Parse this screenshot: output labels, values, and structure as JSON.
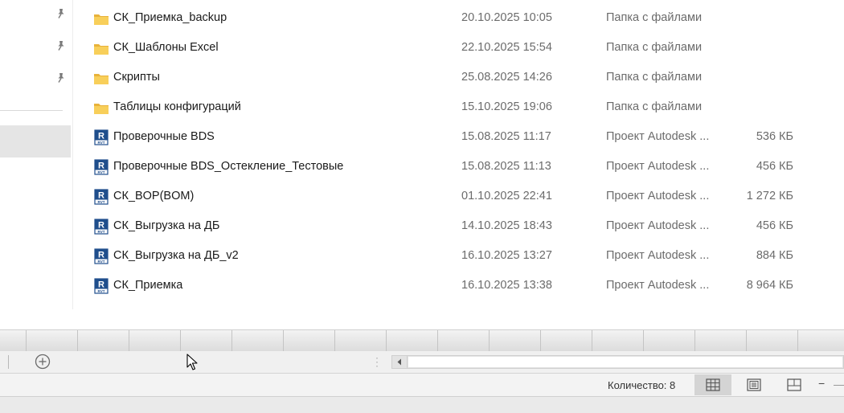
{
  "files": [
    {
      "icon": "folder-icon",
      "name": "СК_Приемка_backup",
      "date": "20.10.2025 10:05",
      "type": "Папка с файлами",
      "size": ""
    },
    {
      "icon": "folder-icon",
      "name": "СК_Шаблоны Excel",
      "date": "22.10.2025 15:54",
      "type": "Папка с файлами",
      "size": ""
    },
    {
      "icon": "folder-icon",
      "name": "Скрипты",
      "date": "25.08.2025 14:26",
      "type": "Папка с файлами",
      "size": ""
    },
    {
      "icon": "folder-icon",
      "name": "Таблицы конфигураций",
      "date": "15.10.2025 19:06",
      "type": "Папка с файлами",
      "size": ""
    },
    {
      "icon": "revit-file-icon",
      "name": "Проверочные BDS",
      "date": "15.08.2025 11:17",
      "type": "Проект Autodesk ...",
      "size": "536 КБ"
    },
    {
      "icon": "revit-file-icon",
      "name": "Проверочные BDS_Остекление_Тестовые",
      "date": "15.08.2025 11:13",
      "type": "Проект Autodesk ...",
      "size": "456 КБ"
    },
    {
      "icon": "revit-file-icon",
      "name": "СК_BOP(BOM)",
      "date": "01.10.2025 22:41",
      "type": "Проект Autodesk ...",
      "size": "1 272 КБ"
    },
    {
      "icon": "revit-file-icon",
      "name": "СК_Выгрузка на ДБ",
      "date": "14.10.2025 18:43",
      "type": "Проект Autodesk ...",
      "size": "456 КБ"
    },
    {
      "icon": "revit-file-icon",
      "name": "СК_Выгрузка на ДБ_v2",
      "date": "16.10.2025 13:27",
      "type": "Проект Autodesk ...",
      "size": "884 КБ"
    },
    {
      "icon": "revit-file-icon",
      "name": "СК_Приемка",
      "date": "16.10.2025 13:38",
      "type": "Проект Autodesk ...",
      "size": "8 964 КБ"
    }
  ],
  "status_bar": {
    "count_label": "Количество: 8"
  },
  "icons": {
    "pin": "pin-icon",
    "add_sheet": "plus-circle-icon",
    "scroll_left": "triangle-left-icon",
    "view_normal": "normal-view-icon",
    "view_page_layout": "page-layout-icon",
    "view_page_break": "page-break-preview-icon",
    "cursor": "mouse-pointer-icon"
  },
  "colors": {
    "folder": "#f5c542",
    "revit_icon": "#1f4e8c",
    "secondary_text": "#6b6b6b"
  }
}
